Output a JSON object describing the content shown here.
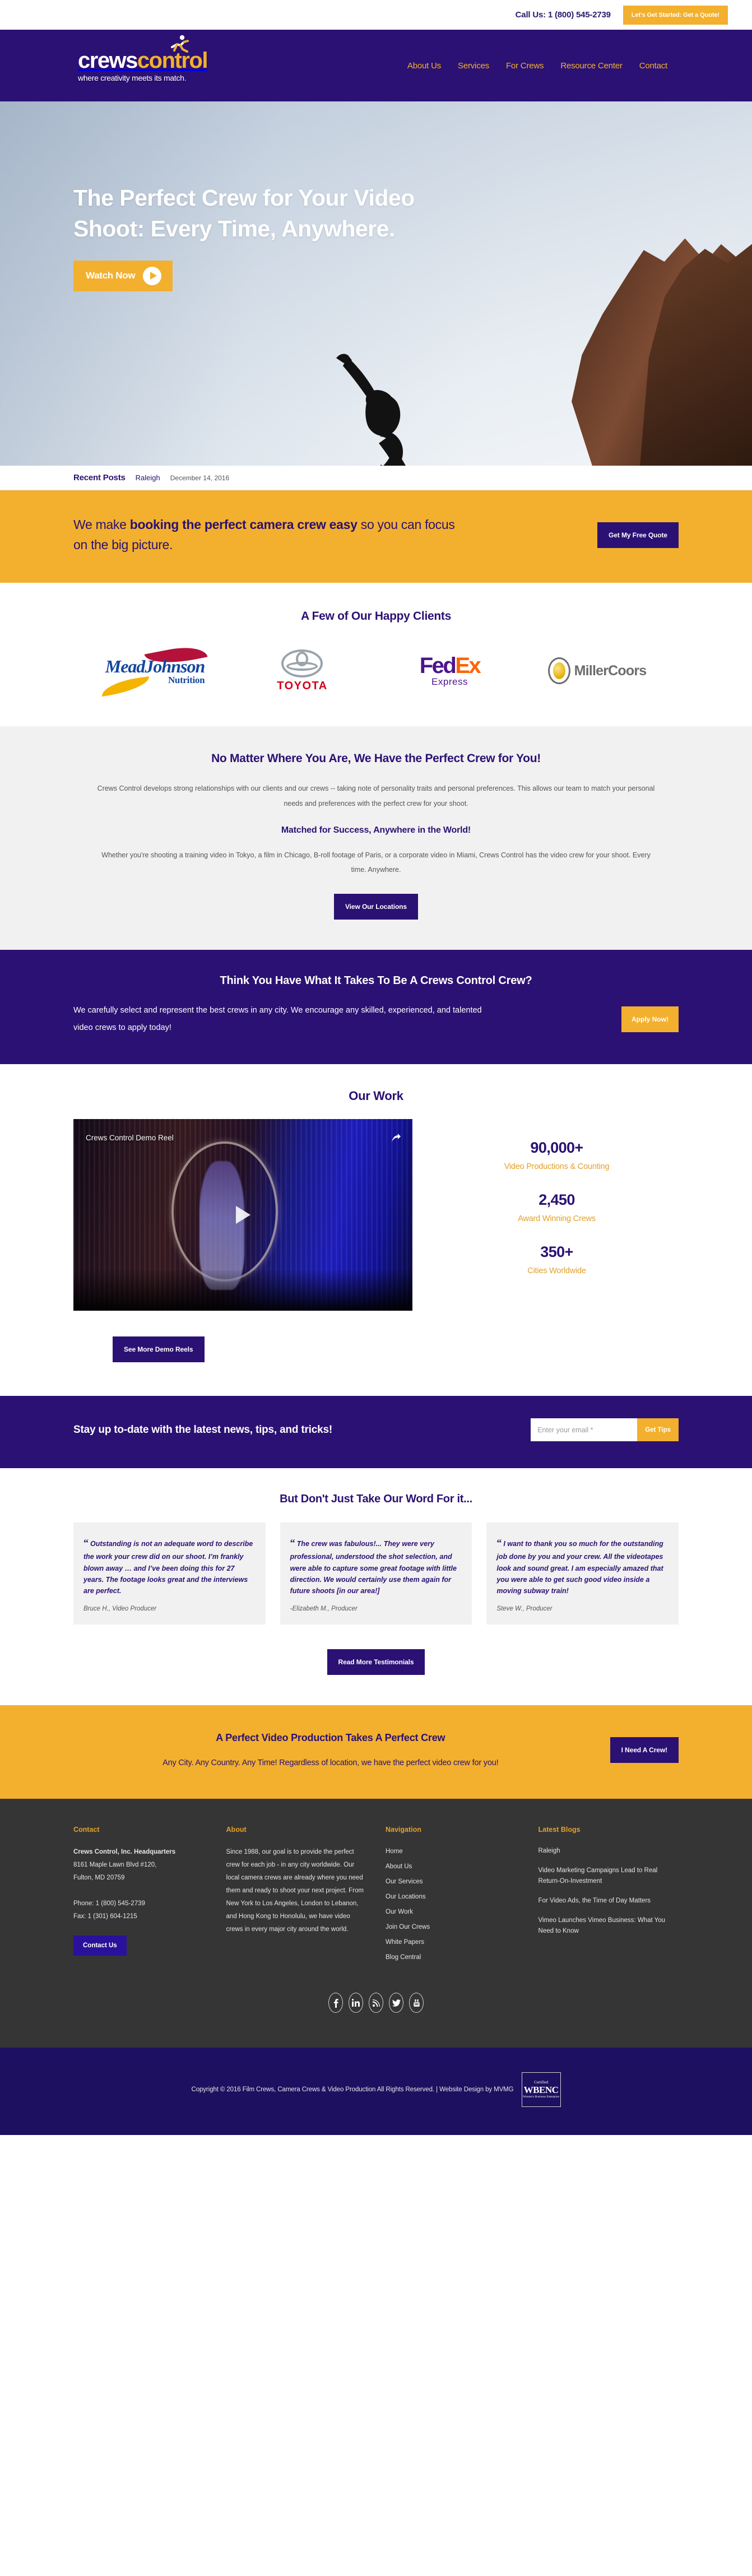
{
  "topbar": {
    "call_us": "Call Us: 1 (800) 545-2739",
    "quote_button": "Let's Get Started: Get a Quote!"
  },
  "brand": {
    "logo_part1": "crews",
    "logo_part2": "control",
    "tagline": "where creativity meets its match.",
    "colors": {
      "purple": "#2b1173",
      "yellow": "#f2b02e",
      "dark": "#353535",
      "deep_purple": "#1d1060"
    }
  },
  "nav": {
    "items": [
      {
        "label": "About Us"
      },
      {
        "label": "Services"
      },
      {
        "label": "For Crews"
      },
      {
        "label": "Resource Center"
      },
      {
        "label": "Contact"
      }
    ]
  },
  "hero": {
    "headline_line1": "The Perfect Crew for Your Video",
    "headline_line2": "Shoot: Every Time, Anywhere.",
    "watch_button": "Watch Now"
  },
  "recent_posts": {
    "label": "Recent Posts",
    "post_title": "Raleigh",
    "date": "December 14, 2016"
  },
  "cta_booking": {
    "text_plain_1": "We make ",
    "text_bold": "booking the perfect camera crew easy",
    "text_plain_2": " so you can focus on the big picture.",
    "button": "Get My Free Quote"
  },
  "clients": {
    "heading": "A Few of Our Happy Clients",
    "logos": [
      {
        "name": "Mead Johnson Nutrition",
        "line1": "MeadJohnson",
        "line2": "Nutrition"
      },
      {
        "name": "Toyota",
        "wordmark": "TOYOTA"
      },
      {
        "name": "FedEx Express",
        "word1": "Fed",
        "word2": "Ex",
        "sub": "Express"
      },
      {
        "name": "MillerCoors",
        "wordmark": "MillerCoors"
      }
    ]
  },
  "perfect_crew": {
    "heading": "No Matter Where You Are, We Have the Perfect Crew for You!",
    "paragraph1": "Crews Control develops strong relationships with our clients and our crews -- taking note of personality traits and personal preferences. This allows our team to match your personal needs and preferences with the perfect crew for your shoot.",
    "subheading": "Matched for Success, Anywhere in the World!",
    "paragraph2": "Whether you're shooting a training video in Tokyo, a film in Chicago, B-roll footage of Paris, or a corporate video in Miami, Crews Control has the video crew for your shoot. Every time. Anywhere.",
    "button": "View Our Locations"
  },
  "join_crew": {
    "heading": "Think You Have What It Takes To Be A Crews Control Crew?",
    "paragraph": "We carefully select and represent the best crews in any city. We encourage any skilled, experienced, and talented video crews to apply today!",
    "button": "Apply Now!"
  },
  "our_work": {
    "heading": "Our Work",
    "video_title": "Crews Control Demo Reel",
    "button": "See More Demo Reels",
    "stats": [
      {
        "number": "90,000+",
        "label": "Video Productions & Counting"
      },
      {
        "number": "2,450",
        "label": "Award Winning Crews"
      },
      {
        "number": "350+",
        "label": "Cities Worldwide"
      }
    ]
  },
  "newsletter": {
    "heading": "Stay up to-date with the latest news, tips, and tricks!",
    "placeholder": "Enter your email *",
    "value": "",
    "button": "Get Tips"
  },
  "testimonials": {
    "heading": "But Don't Just Take Our Word For it...",
    "items": [
      {
        "quote": "Outstanding is not an adequate word to describe the work your crew did on our shoot. I’m frankly blown away … and I’ve been doing this for 27 years. The footage looks great and the interviews are perfect.",
        "author": "Bruce H., Video Producer"
      },
      {
        "quote": "The crew was fabulous!... They were very professional, understood the shot selection, and were able to capture some great footage with little direction. We would certainly use them again for future shoots [in our area!]",
        "author": "-Elizabeth M., Producer"
      },
      {
        "quote": "I want to thank you so much for the outstanding job done by you and your crew. All the videotapes look and sound great. I am especially amazed that you were able to get such good video inside a moving subway train!",
        "author": "Steve W., Producer"
      }
    ],
    "button": "Read More Testimonials"
  },
  "cta_crew": {
    "heading": "A Perfect Video Production Takes A Perfect Crew",
    "paragraph": "Any City. Any Country. Any Time! Regardless of location, we have the perfect video crew for you!",
    "button": "I Need A Crew!"
  },
  "footer": {
    "contact": {
      "heading": "Contact",
      "company": "Crews Control, Inc. Headquarters",
      "address1": "8161 Maple Lawn Blvd #120,",
      "address2": "Fulton, MD 20759",
      "phone": "Phone: 1 (800) 545-2739",
      "fax": "Fax: 1 (301) 604-1215",
      "button": "Contact Us"
    },
    "about": {
      "heading": "About",
      "text": "Since 1988, our goal is to provide the perfect crew for each job - in any city worldwide. Our local camera crews are already where you need them and ready to shoot your next project. From New York to Los Angeles, London to Lebanon, and Hong Kong to Honolulu, we have video crews in every major city around the world."
    },
    "navigation": {
      "heading": "Navigation",
      "items": [
        {
          "label": "Home"
        },
        {
          "label": "About Us"
        },
        {
          "label": "Our Services"
        },
        {
          "label": "Our Locations"
        },
        {
          "label": "Our Work"
        },
        {
          "label": "Join Our Crews"
        },
        {
          "label": "White Papers"
        },
        {
          "label": "Blog Central"
        }
      ]
    },
    "blogs": {
      "heading": "Latest Blogs",
      "items": [
        {
          "title": "Raleigh"
        },
        {
          "title": "Video Marketing Campaigns Lead to Real Return-On-Investment"
        },
        {
          "title": "For Video Ads, the Time of Day Matters"
        },
        {
          "title": "Vimeo Launches Vimeo Business: What You Need to Know"
        }
      ]
    },
    "social": [
      {
        "name": "facebook",
        "glyph": "f"
      },
      {
        "name": "linkedin",
        "glyph": "in"
      },
      {
        "name": "rss",
        "glyph": "◔"
      },
      {
        "name": "twitter",
        "glyph": "ᵛ"
      },
      {
        "name": "youtube",
        "glyph": "▶"
      }
    ],
    "copyright": "Copyright © 2016 Film Crews, Camera Crews & Video Production All Rights Reserved. | Website Design by MVMG",
    "badge": {
      "line1": "Certified",
      "line2": "WBENC",
      "line3": "Women's Business Enterprise"
    }
  }
}
